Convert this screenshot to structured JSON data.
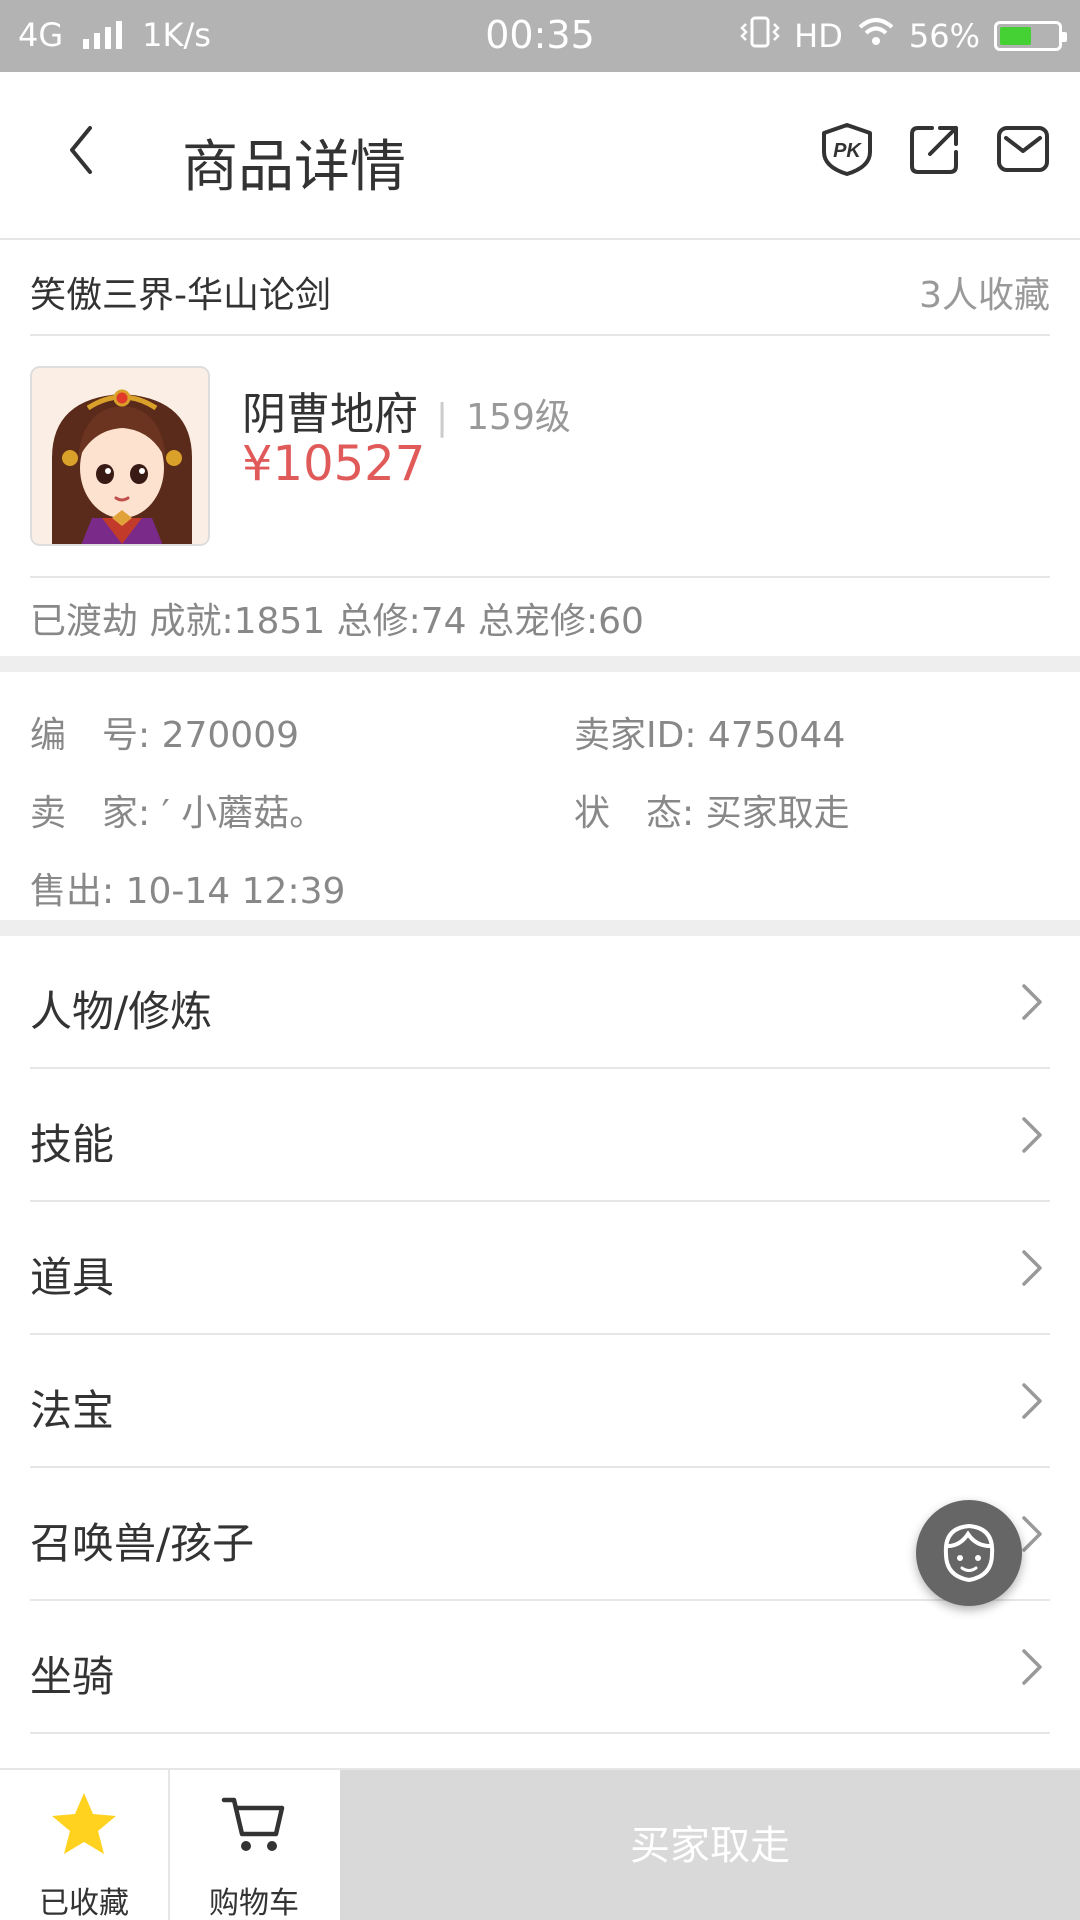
{
  "status_bar": {
    "network": "4G",
    "speed": "1K/s",
    "time": "00:35",
    "hd": "HD",
    "battery": "56%",
    "battery_level": 0.56
  },
  "nav": {
    "title": "商品详情",
    "icons": [
      "back-icon",
      "pk-icon",
      "share-icon",
      "mail-icon"
    ]
  },
  "item": {
    "server": "笑傲三界-华山论剑",
    "favorites": "3人收藏",
    "name": "阴曹地府",
    "level": "159级",
    "price": "¥10527",
    "stats": "已渡劫 成就:1851 总修:74 总宠修:60"
  },
  "info": {
    "number_label": "编　号:",
    "number_value": "270009",
    "seller_id_label": "卖家ID:",
    "seller_id_value": "475044",
    "seller_label": "卖　家:",
    "seller_value": "′ 小蘑菇。",
    "status_label": "状　态:",
    "status_value": "买家取走",
    "sold_label": "售出:",
    "sold_value": "10-14 12:39"
  },
  "sections": [
    "人物/修炼",
    "技能",
    "道具",
    "法宝",
    "召唤兽/孩子",
    "坐骑"
  ],
  "bottom": {
    "favorited_label": "已收藏",
    "cart_label": "购物车",
    "action_label": "买家取走"
  }
}
